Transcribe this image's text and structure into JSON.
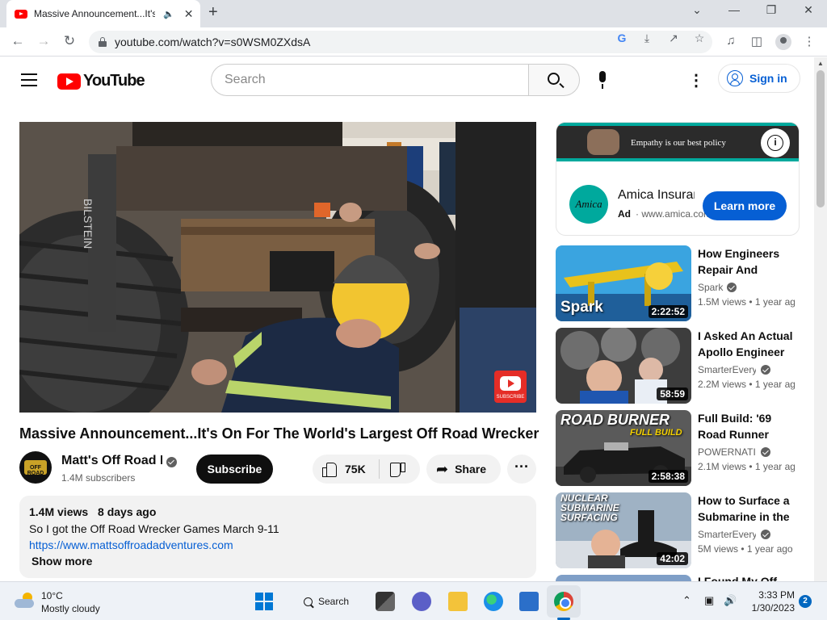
{
  "browser": {
    "tab_title": "Massive Announcement...It's On For The World's Largest Off Road Wrecker",
    "url": "youtube.com/watch?v=s0WSM0ZXdsA",
    "icons": [
      "back-icon",
      "forward-icon",
      "reload-icon",
      "lock-icon",
      "google-lens-icon",
      "install-icon",
      "share-icon",
      "bookmark-star-icon",
      "media-icon",
      "side-panel-icon",
      "profile-icon",
      "menu-icon"
    ]
  },
  "youtube_header": {
    "logo_text": "YouTube",
    "search_placeholder": "Search",
    "signin_label": "Sign in"
  },
  "video": {
    "title": "Massive Announcement...It's On For The World's Largest Off Road Wrecker",
    "watermark_text": "SUBSCRIBE",
    "channel": {
      "avatar_text": "OFF ROAD",
      "name": "Matt's Off Road Recovery",
      "subscribers": "1.4M subscribers",
      "verified": true
    },
    "subscribe_label": "Subscribe",
    "likes": "75K",
    "share_label": "Share",
    "more_label": "···",
    "description": {
      "views": "1.4M views",
      "date": "8 days ago",
      "line1": "So I got the Off Road Wrecker Games March 9-11",
      "link": "https://www.mattsoffroadadventures.com",
      "show_more": "Show more"
    }
  },
  "ad": {
    "banner_text": "Empathy is our best policy",
    "logo_text": "Amica",
    "name": "Amica Insurance",
    "ad_label": "Ad",
    "domain": "www.amica.com",
    "cta": "Learn more",
    "info_label": "i",
    "accent_color": "#00a99d"
  },
  "related": [
    {
      "title": "How Engineers Repair And Maintain",
      "channel": "Spark",
      "verified": true,
      "views": "1.5M views",
      "age": "1 year ago",
      "duration": "2:22:52",
      "overlay": "Spark"
    },
    {
      "title": "I Asked An Actual Apollo Engineer",
      "channel": "SmarterEveryDay",
      "verified": true,
      "views": "2.2M views",
      "age": "1 year ago",
      "duration": "58:59",
      "overlay": ""
    },
    {
      "title": "Full Build: '69 Road Runner",
      "channel": "POWERNATION",
      "verified": true,
      "views": "2.1M views",
      "age": "1 year ago",
      "duration": "2:58:38",
      "overlay": "ROAD BURNER",
      "overlay2": "FULL BUILD"
    },
    {
      "title": "How to Surface a Submarine in the Arctic",
      "channel": "SmarterEveryDay",
      "verified": true,
      "views": "5M views",
      "age": "1 year ago",
      "duration": "42:02",
      "overlay": "NUCLEAR SUBMARINE SURFACING"
    },
    {
      "title": "I Found My Off",
      "channel": "",
      "verified": false,
      "views": "",
      "age": "",
      "duration": "",
      "overlay": ""
    }
  ],
  "taskbar": {
    "temperature": "10°C",
    "condition": "Mostly cloudy",
    "search_label": "Search",
    "time": "3:33 PM",
    "date": "1/30/2023",
    "notifications": "2"
  }
}
